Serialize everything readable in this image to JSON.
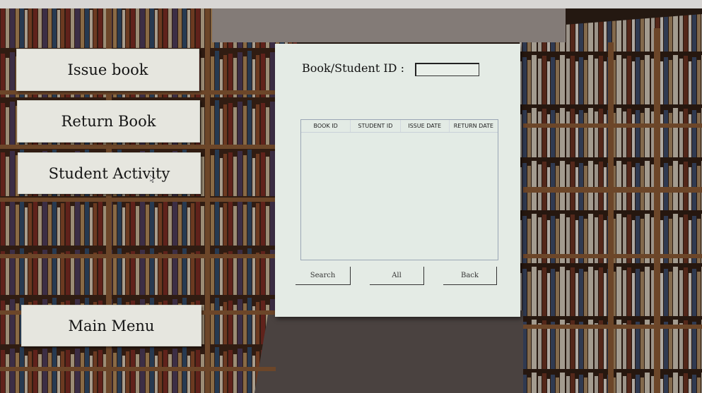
{
  "menu": {
    "issue_book": "Issue book",
    "return_book": "Return Book",
    "student_activity": "Student Activity",
    "main_menu": "Main Menu"
  },
  "panel": {
    "id_label": "Book/Student ID :",
    "id_value": "",
    "table": {
      "columns": [
        "BOOK ID",
        "STUDENT ID",
        "ISSUE DATE",
        "RETURN DATE"
      ],
      "rows": []
    },
    "buttons": {
      "search": "Search",
      "all": "All",
      "back": "Back"
    }
  }
}
